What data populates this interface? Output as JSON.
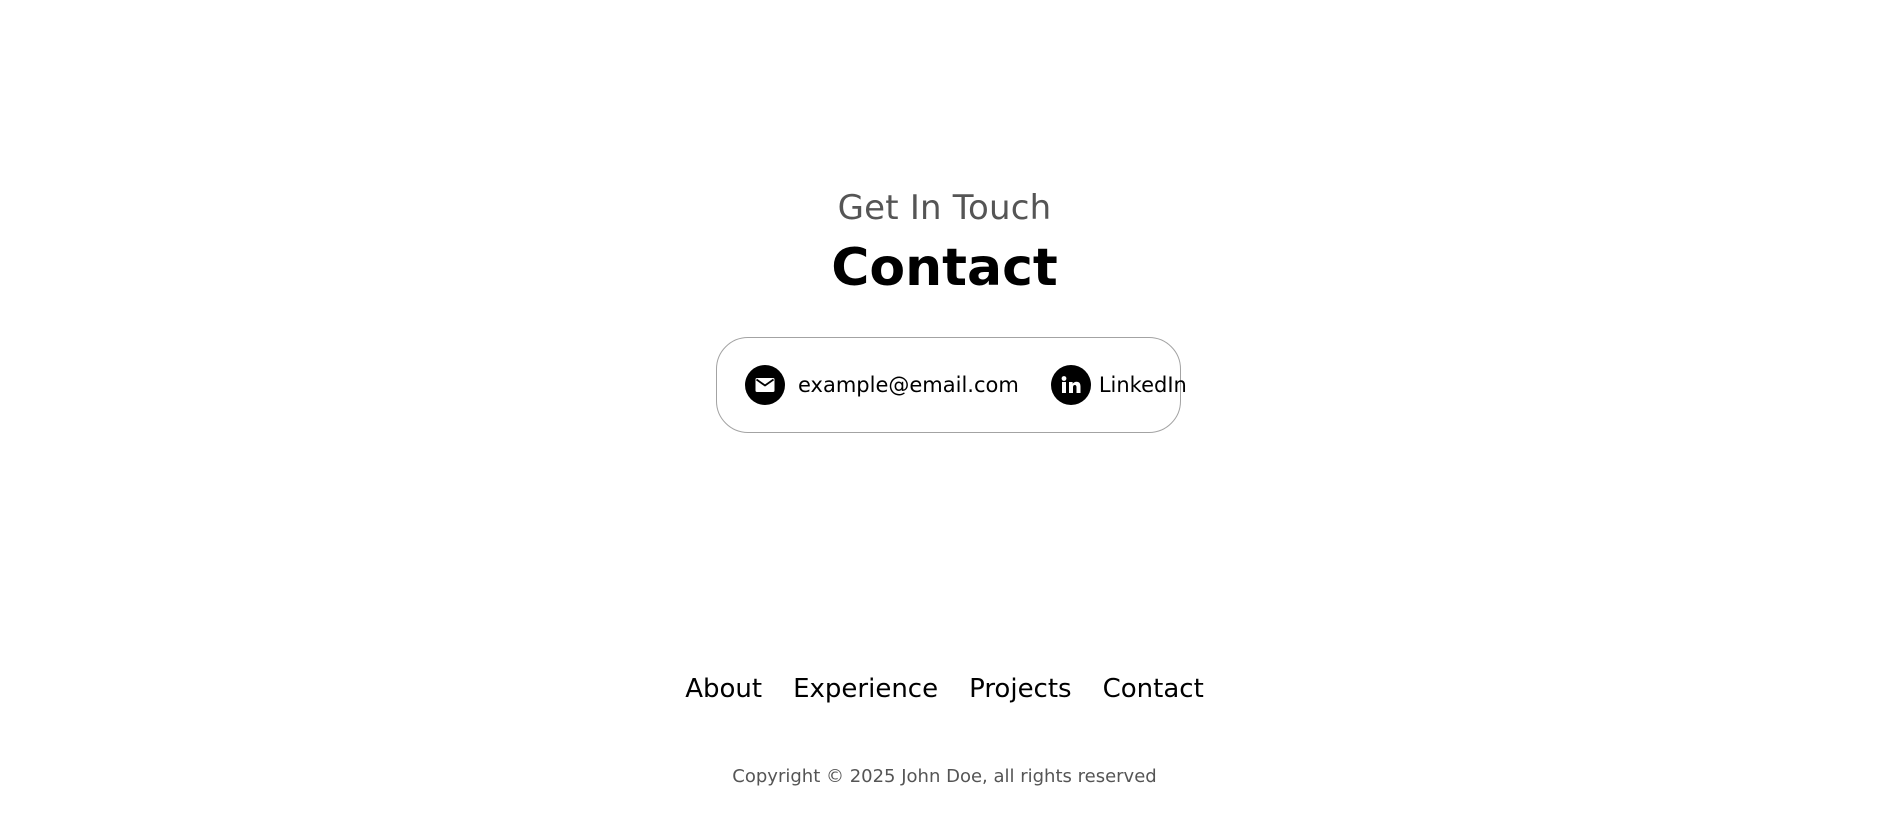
{
  "contact": {
    "eyebrow": "Get In Touch",
    "title": "Contact",
    "email": {
      "icon": "email-icon",
      "label": "example@email.com"
    },
    "linkedin": {
      "icon": "linkedin-icon",
      "label": "LinkedIn"
    }
  },
  "footer": {
    "nav": [
      "About",
      "Experience",
      "Projects",
      "Contact"
    ],
    "copyright": "Copyright © 2025 John Doe, all rights reserved"
  },
  "colors": {
    "background": "#ffffff",
    "text": "#000000",
    "muted_text": "#555555",
    "card_border": "#a3a3a3"
  }
}
